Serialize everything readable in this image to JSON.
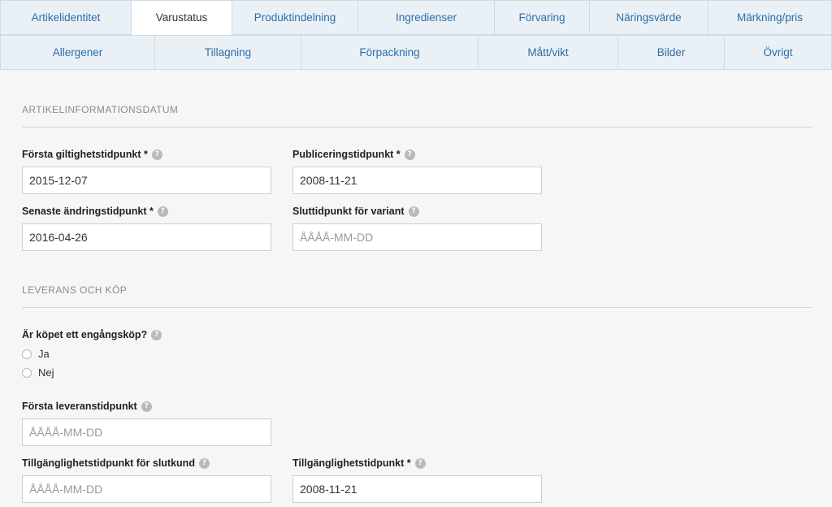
{
  "tabs": {
    "row1": [
      {
        "label": "Artikelidentitet"
      },
      {
        "label": "Varustatus"
      },
      {
        "label": "Produktindelning"
      },
      {
        "label": "Ingredienser"
      },
      {
        "label": "Förvaring"
      },
      {
        "label": "Näringsvärde"
      },
      {
        "label": "Märkning/pris"
      }
    ],
    "row2": [
      {
        "label": "Allergener"
      },
      {
        "label": "Tillagning"
      },
      {
        "label": "Förpackning"
      },
      {
        "label": "Mått/vikt"
      },
      {
        "label": "Bilder"
      },
      {
        "label": "Övrigt"
      }
    ]
  },
  "section1": {
    "title": "ARTIKELINFORMATIONSDATUM",
    "first_valid": {
      "label": "Första giltighetstidpunkt *",
      "value": "2015-12-07"
    },
    "published": {
      "label": "Publiceringstidpunkt *",
      "value": "2008-11-21"
    },
    "last_changed": {
      "label": "Senaste ändringstidpunkt *",
      "value": "2016-04-26"
    },
    "variant_end": {
      "label": "Sluttidpunkt för variant",
      "value": "",
      "placeholder": "ÅÅÅÅ-MM-DD"
    }
  },
  "section2": {
    "title": "LEVERANS OCH KÖP",
    "one_time": {
      "label": "Är köpet ett engångsköp?",
      "options": [
        "Ja",
        "Nej"
      ]
    },
    "first_delivery": {
      "label": "Första leveranstidpunkt",
      "value": "",
      "placeholder": "ÅÅÅÅ-MM-DD"
    },
    "avail_end_customer": {
      "label": "Tillgänglighetstidpunkt för slutkund",
      "value": "",
      "placeholder": "ÅÅÅÅ-MM-DD"
    },
    "availability": {
      "label": "Tillgänglighetstidpunkt *",
      "value": "2008-11-21"
    }
  },
  "icons": {
    "help": "?"
  }
}
